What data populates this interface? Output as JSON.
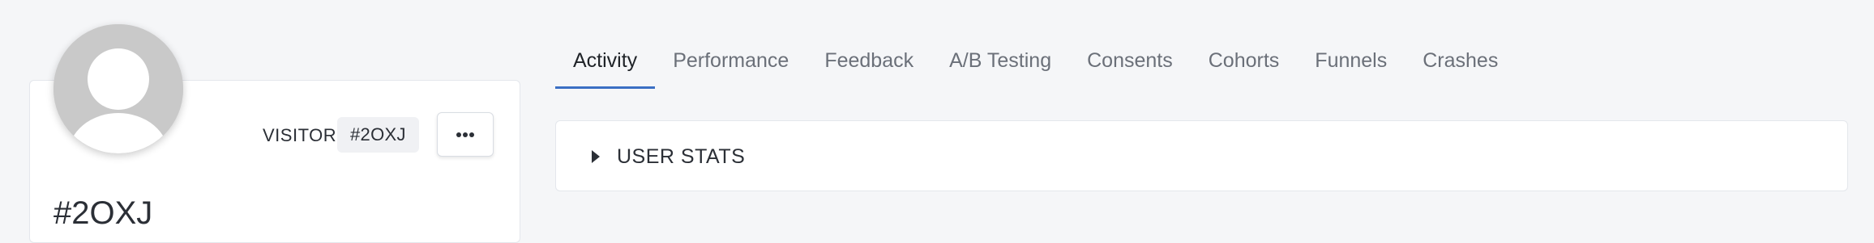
{
  "profile": {
    "visitor_label": "VISITOR",
    "visitor_id": "#2OXJ",
    "display_id": "#2OXJ",
    "more_button_icon": "more-horizontal-icon",
    "avatar_icon": "user-avatar-icon"
  },
  "tabs": [
    {
      "label": "Activity",
      "active": true
    },
    {
      "label": "Performance",
      "active": false
    },
    {
      "label": "Feedback",
      "active": false
    },
    {
      "label": "A/B Testing",
      "active": false
    },
    {
      "label": "Consents",
      "active": false
    },
    {
      "label": "Cohorts",
      "active": false
    },
    {
      "label": "Funnels",
      "active": false
    },
    {
      "label": "Crashes",
      "active": false
    }
  ],
  "stats_panel": {
    "title": "USER STATS",
    "expand_icon": "caret-right-icon"
  },
  "colors": {
    "background": "#f5f6f8",
    "active_tab_underline": "#3b6fc4",
    "avatar": "#c9c9c9"
  }
}
